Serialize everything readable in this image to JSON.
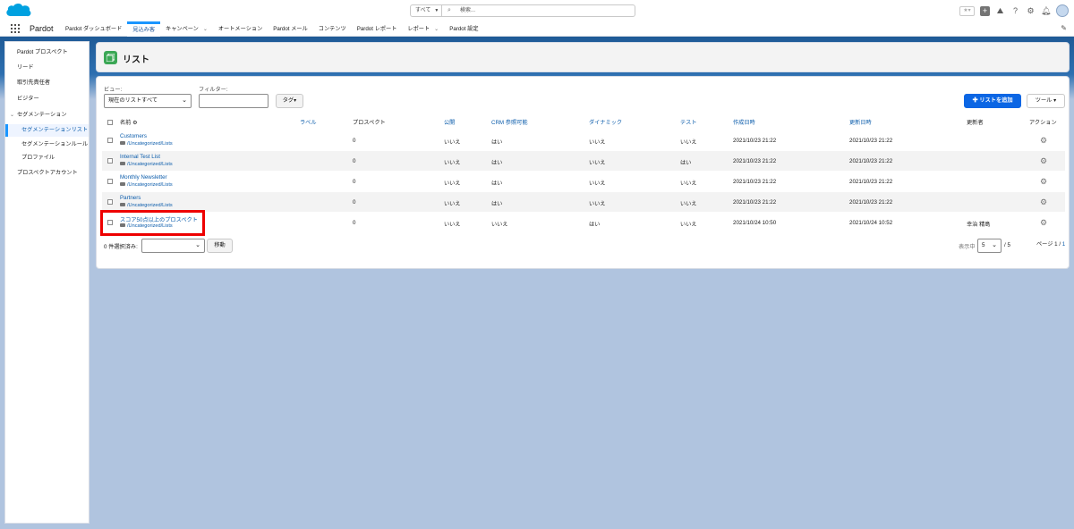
{
  "header": {
    "search_scope": "すべて",
    "search_placeholder": "検索..."
  },
  "nav": {
    "app_name": "Pardot",
    "items": [
      {
        "label": "Pardot ダッシュボード",
        "chevron": false
      },
      {
        "label": "見込み客",
        "chevron": false,
        "active": true
      },
      {
        "label": "キャンペーン",
        "chevron": true
      },
      {
        "label": "オートメーション",
        "chevron": false
      },
      {
        "label": "Pardot メール",
        "chevron": false
      },
      {
        "label": "コンテンツ",
        "chevron": false
      },
      {
        "label": "Pardot レポート",
        "chevron": false
      },
      {
        "label": "レポート",
        "chevron": true
      },
      {
        "label": "Pardot 設定",
        "chevron": false
      }
    ]
  },
  "sidebar": {
    "items": [
      {
        "label": "Pardot プロスペクト",
        "level": "top"
      },
      {
        "label": "リード",
        "level": "top"
      },
      {
        "label": "取引先責任者",
        "level": "top"
      },
      {
        "label": "ビジター",
        "level": "top"
      },
      {
        "label": "セグメンテーション",
        "level": "parent"
      },
      {
        "label": "セグメンテーションリスト",
        "level": "sub",
        "active": true
      },
      {
        "label": "セグメンテーションルール",
        "level": "sub"
      },
      {
        "label": "プロファイル",
        "level": "sub"
      },
      {
        "label": "プロスペクトアカウント",
        "level": "top"
      }
    ]
  },
  "page": {
    "title": "リスト"
  },
  "filters": {
    "view_label": "ビュー:",
    "view_value": "現在のリストすべて",
    "filter_label": "フィルター:",
    "tag_button": "タグ▾",
    "add_list_button": "✚ リストを追加",
    "tools_button": "ツール ▾"
  },
  "table": {
    "headers": {
      "name": "名前 ⚙",
      "label": "ラベル",
      "prospects": "プロスペクト",
      "public": "公開",
      "crm": "CRM 参照可能",
      "dynamic": "ダイナミック",
      "test": "テスト",
      "created": "作成日時",
      "updated": "更新日時",
      "updated_by": "更新者",
      "action": "アクション"
    },
    "rows": [
      {
        "name": "Customers",
        "folder": "/Uncategorized/Lists",
        "label": "",
        "prospects": "0",
        "public": "いいえ",
        "crm": "はい",
        "dynamic": "いいえ",
        "test": "いいえ",
        "created": "2021/10/23 21:22",
        "updated": "2021/10/23 21:22",
        "updated_by": ""
      },
      {
        "name": "Internal Test List",
        "folder": "/Uncategorized/Lists",
        "label": "",
        "prospects": "0",
        "public": "いいえ",
        "crm": "はい",
        "dynamic": "いいえ",
        "test": "はい",
        "created": "2021/10/23 21:22",
        "updated": "2021/10/23 21:22",
        "updated_by": ""
      },
      {
        "name": "Monthly Newsletter",
        "folder": "/Uncategorized/Lists",
        "label": "",
        "prospects": "0",
        "public": "いいえ",
        "crm": "はい",
        "dynamic": "いいえ",
        "test": "いいえ",
        "created": "2021/10/23 21:22",
        "updated": "2021/10/23 21:22",
        "updated_by": ""
      },
      {
        "name": "Partners",
        "folder": "/Uncategorized/Lists",
        "label": "",
        "prospects": "0",
        "public": "いいえ",
        "crm": "はい",
        "dynamic": "いいえ",
        "test": "いいえ",
        "created": "2021/10/23 21:22",
        "updated": "2021/10/23 21:22",
        "updated_by": ""
      },
      {
        "name": "スコア50点以上のプロスペクト",
        "folder": "/Uncategorized/Lists",
        "label": "",
        "prospects": "0",
        "public": "いいえ",
        "crm": "いいえ",
        "dynamic": "はい",
        "test": "いいえ",
        "created": "2021/10/24 10:50",
        "updated": "2021/10/24 10:52",
        "updated_by": "幸治 精島"
      }
    ]
  },
  "footer": {
    "selected": "0 件選択済み:",
    "move_button": "移動",
    "showing_label": "表示中",
    "per_page": "5",
    "total": "/ 5",
    "page_label": "ページ 1 /",
    "page_total": "1"
  },
  "colors": {
    "accent": "#0b66e4",
    "brand_band": "#1f5a96",
    "highlight": "#ee0000"
  }
}
